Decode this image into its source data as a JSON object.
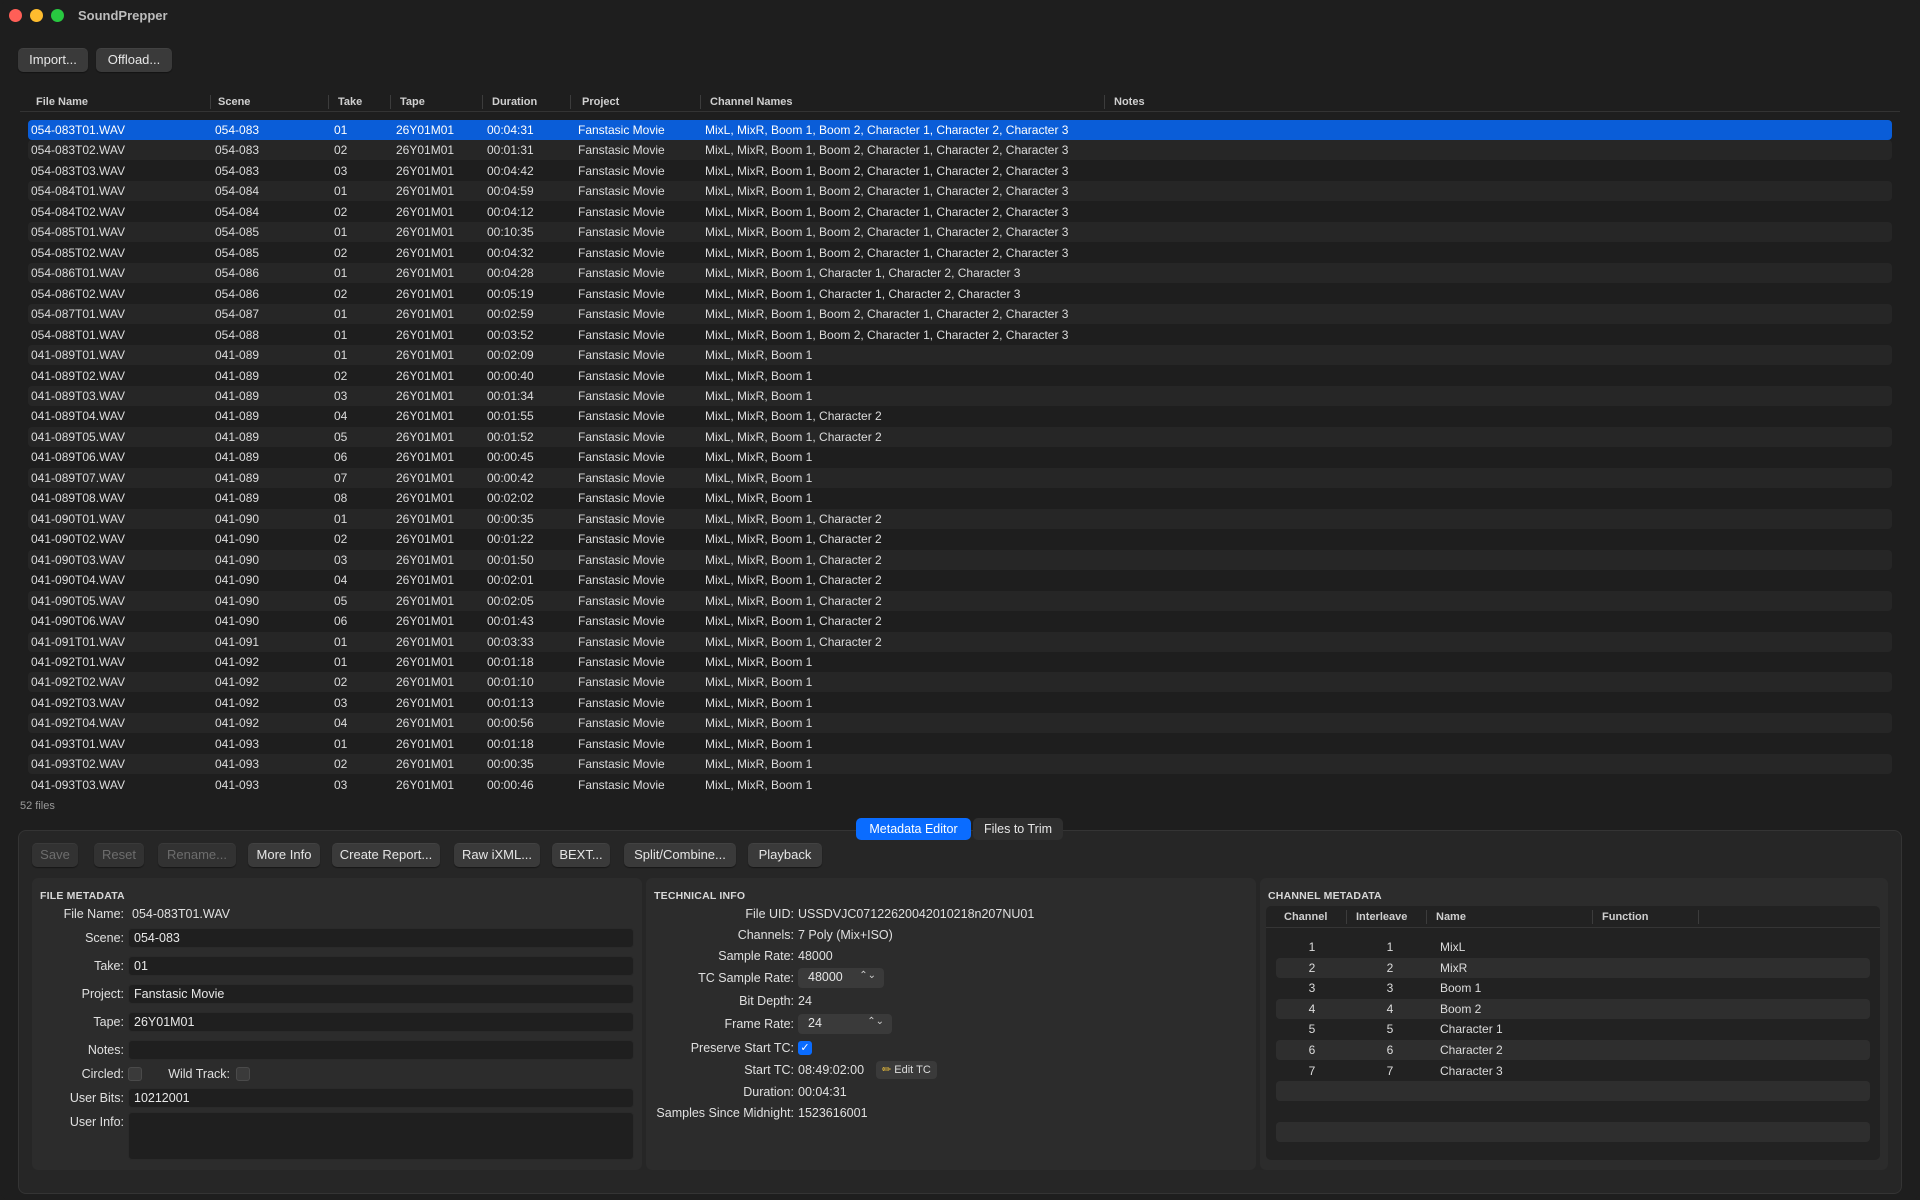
{
  "app": {
    "title": "SoundPrepper"
  },
  "toolbar": {
    "import_label": "Import...",
    "offload_label": "Offload..."
  },
  "table": {
    "columns": [
      "File Name",
      "Scene",
      "Take",
      "Tape",
      "Duration",
      "Project",
      "Channel Names",
      "Notes"
    ],
    "rows": [
      [
        "054-083T01.WAV",
        "054-083",
        "01",
        "26Y01M01",
        "00:04:31",
        "Fanstasic Movie",
        "MixL, MixR, Boom 1, Boom 2, Character 1, Character 2, Character 3"
      ],
      [
        "054-083T02.WAV",
        "054-083",
        "02",
        "26Y01M01",
        "00:01:31",
        "Fanstasic Movie",
        "MixL, MixR, Boom 1, Boom 2, Character 1, Character 2, Character 3"
      ],
      [
        "054-083T03.WAV",
        "054-083",
        "03",
        "26Y01M01",
        "00:04:42",
        "Fanstasic Movie",
        "MixL, MixR, Boom 1, Boom 2, Character 1, Character 2, Character 3"
      ],
      [
        "054-084T01.WAV",
        "054-084",
        "01",
        "26Y01M01",
        "00:04:59",
        "Fanstasic Movie",
        "MixL, MixR, Boom 1, Boom 2, Character 1, Character 2, Character 3"
      ],
      [
        "054-084T02.WAV",
        "054-084",
        "02",
        "26Y01M01",
        "00:04:12",
        "Fanstasic Movie",
        "MixL, MixR, Boom 1, Boom 2, Character 1, Character 2, Character 3"
      ],
      [
        "054-085T01.WAV",
        "054-085",
        "01",
        "26Y01M01",
        "00:10:35",
        "Fanstasic Movie",
        "MixL, MixR, Boom 1, Boom 2, Character 1, Character 2, Character 3"
      ],
      [
        "054-085T02.WAV",
        "054-085",
        "02",
        "26Y01M01",
        "00:04:32",
        "Fanstasic Movie",
        "MixL, MixR, Boom 1, Boom 2, Character 1, Character 2, Character 3"
      ],
      [
        "054-086T01.WAV",
        "054-086",
        "01",
        "26Y01M01",
        "00:04:28",
        "Fanstasic Movie",
        "MixL, MixR, Boom 1, Character 1, Character 2, Character 3"
      ],
      [
        "054-086T02.WAV",
        "054-086",
        "02",
        "26Y01M01",
        "00:05:19",
        "Fanstasic Movie",
        "MixL, MixR, Boom 1, Character 1, Character 2, Character 3"
      ],
      [
        "054-087T01.WAV",
        "054-087",
        "01",
        "26Y01M01",
        "00:02:59",
        "Fanstasic Movie",
        "MixL, MixR, Boom 1, Boom 2, Character 1, Character 2, Character 3"
      ],
      [
        "054-088T01.WAV",
        "054-088",
        "01",
        "26Y01M01",
        "00:03:52",
        "Fanstasic Movie",
        "MixL, MixR, Boom 1, Boom 2, Character 1, Character 2, Character 3"
      ],
      [
        "041-089T01.WAV",
        "041-089",
        "01",
        "26Y01M01",
        "00:02:09",
        "Fanstasic Movie",
        "MixL, MixR, Boom 1"
      ],
      [
        "041-089T02.WAV",
        "041-089",
        "02",
        "26Y01M01",
        "00:00:40",
        "Fanstasic Movie",
        "MixL, MixR, Boom 1"
      ],
      [
        "041-089T03.WAV",
        "041-089",
        "03",
        "26Y01M01",
        "00:01:34",
        "Fanstasic Movie",
        "MixL, MixR, Boom 1"
      ],
      [
        "041-089T04.WAV",
        "041-089",
        "04",
        "26Y01M01",
        "00:01:55",
        "Fanstasic Movie",
        "MixL, MixR, Boom 1, Character 2"
      ],
      [
        "041-089T05.WAV",
        "041-089",
        "05",
        "26Y01M01",
        "00:01:52",
        "Fanstasic Movie",
        "MixL, MixR, Boom 1, Character 2"
      ],
      [
        "041-089T06.WAV",
        "041-089",
        "06",
        "26Y01M01",
        "00:00:45",
        "Fanstasic Movie",
        "MixL, MixR, Boom 1"
      ],
      [
        "041-089T07.WAV",
        "041-089",
        "07",
        "26Y01M01",
        "00:00:42",
        "Fanstasic Movie",
        "MixL, MixR, Boom 1"
      ],
      [
        "041-089T08.WAV",
        "041-089",
        "08",
        "26Y01M01",
        "00:02:02",
        "Fanstasic Movie",
        "MixL, MixR, Boom 1"
      ],
      [
        "041-090T01.WAV",
        "041-090",
        "01",
        "26Y01M01",
        "00:00:35",
        "Fanstasic Movie",
        "MixL, MixR, Boom 1, Character 2"
      ],
      [
        "041-090T02.WAV",
        "041-090",
        "02",
        "26Y01M01",
        "00:01:22",
        "Fanstasic Movie",
        "MixL, MixR, Boom 1, Character 2"
      ],
      [
        "041-090T03.WAV",
        "041-090",
        "03",
        "26Y01M01",
        "00:01:50",
        "Fanstasic Movie",
        "MixL, MixR, Boom 1, Character 2"
      ],
      [
        "041-090T04.WAV",
        "041-090",
        "04",
        "26Y01M01",
        "00:02:01",
        "Fanstasic Movie",
        "MixL, MixR, Boom 1, Character 2"
      ],
      [
        "041-090T05.WAV",
        "041-090",
        "05",
        "26Y01M01",
        "00:02:05",
        "Fanstasic Movie",
        "MixL, MixR, Boom 1, Character 2"
      ],
      [
        "041-090T06.WAV",
        "041-090",
        "06",
        "26Y01M01",
        "00:01:43",
        "Fanstasic Movie",
        "MixL, MixR, Boom 1, Character 2"
      ],
      [
        "041-091T01.WAV",
        "041-091",
        "01",
        "26Y01M01",
        "00:03:33",
        "Fanstasic Movie",
        "MixL, MixR, Boom 1, Character 2"
      ],
      [
        "041-092T01.WAV",
        "041-092",
        "01",
        "26Y01M01",
        "00:01:18",
        "Fanstasic Movie",
        "MixL, MixR, Boom 1"
      ],
      [
        "041-092T02.WAV",
        "041-092",
        "02",
        "26Y01M01",
        "00:01:10",
        "Fanstasic Movie",
        "MixL, MixR, Boom 1"
      ],
      [
        "041-092T03.WAV",
        "041-092",
        "03",
        "26Y01M01",
        "00:01:13",
        "Fanstasic Movie",
        "MixL, MixR, Boom 1"
      ],
      [
        "041-092T04.WAV",
        "041-092",
        "04",
        "26Y01M01",
        "00:00:56",
        "Fanstasic Movie",
        "MixL, MixR, Boom 1"
      ],
      [
        "041-093T01.WAV",
        "041-093",
        "01",
        "26Y01M01",
        "00:01:18",
        "Fanstasic Movie",
        "MixL, MixR, Boom 1"
      ],
      [
        "041-093T02.WAV",
        "041-093",
        "02",
        "26Y01M01",
        "00:00:35",
        "Fanstasic Movie",
        "MixL, MixR, Boom 1"
      ],
      [
        "041-093T03.WAV",
        "041-093",
        "03",
        "26Y01M01",
        "00:00:46",
        "Fanstasic Movie",
        "MixL, MixR, Boom 1"
      ]
    ],
    "file_count": "52 files"
  },
  "tabs": {
    "metadata_editor": "Metadata Editor",
    "files_to_trim": "Files to Trim"
  },
  "actions": {
    "save": "Save",
    "reset": "Reset",
    "rename": "Rename...",
    "more_info": "More Info",
    "create_report": "Create Report...",
    "raw_ixml": "Raw iXML...",
    "bext": "BEXT...",
    "split_combine": "Split/Combine...",
    "playback": "Playback"
  },
  "file_metadata": {
    "title": "FILE METADATA",
    "file_name_label": "File Name:",
    "file_name": "054-083T01.WAV",
    "scene_label": "Scene:",
    "scene": "054-083",
    "take_label": "Take:",
    "take": "01",
    "project_label": "Project:",
    "project": "Fanstasic Movie",
    "tape_label": "Tape:",
    "tape": "26Y01M01",
    "notes_label": "Notes:",
    "notes": "",
    "circled_label": "Circled:",
    "wild_track_label": "Wild Track:",
    "user_bits_label": "User Bits:",
    "user_bits": "10212001",
    "user_info_label": "User Info:",
    "user_info": ""
  },
  "technical_info": {
    "title": "TECHNICAL INFO",
    "file_uid_label": "File UID:",
    "file_uid": "USSDVJC07122620042010218n207NU01",
    "channels_label": "Channels:",
    "channels": "7 Poly (Mix+ISO)",
    "sample_rate_label": "Sample Rate:",
    "sample_rate": "48000",
    "tc_sample_rate_label": "TC Sample Rate:",
    "tc_sample_rate": "48000",
    "bit_depth_label": "Bit Depth:",
    "bit_depth": "24",
    "frame_rate_label": "Frame Rate:",
    "frame_rate": "24",
    "preserve_start_tc_label": "Preserve Start TC:",
    "start_tc_label": "Start TC:",
    "start_tc": "08:49:02:00",
    "edit_tc_label": "Edit TC",
    "duration_label": "Duration:",
    "duration": "00:04:31",
    "samples_since_midnight_label": "Samples Since Midnight:",
    "samples_since_midnight": "1523616001"
  },
  "channel_metadata": {
    "title": "CHANNEL METADATA",
    "columns": [
      "Channel",
      "Interleave",
      "Name",
      "Function"
    ],
    "rows": [
      [
        "1",
        "1",
        "MixL"
      ],
      [
        "2",
        "2",
        "MixR"
      ],
      [
        "3",
        "3",
        "Boom 1"
      ],
      [
        "4",
        "4",
        "Boom 2"
      ],
      [
        "5",
        "5",
        "Character 1"
      ],
      [
        "6",
        "6",
        "Character 2"
      ],
      [
        "7",
        "7",
        "Character 3"
      ]
    ]
  },
  "colors": {
    "selection": "#0a5dd8",
    "accent": "#0a6cff",
    "background": "#1e1e1e"
  }
}
